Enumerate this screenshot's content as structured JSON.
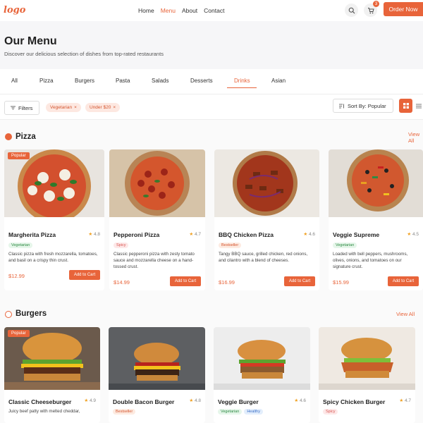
{
  "nav": {
    "logo": "logo",
    "links": [
      "Home",
      "Menu",
      "About",
      "Contact"
    ],
    "active_link": "Menu",
    "cart_count": "3",
    "order_now": "Order Now"
  },
  "hero": {
    "title": "Our Menu",
    "subtitle": "Discover our delicious selection of dishes from top-rated restaurants"
  },
  "tabs": {
    "items": [
      "All",
      "Pizza",
      "Burgers",
      "Pasta",
      "Salads",
      "Desserts",
      "Drinks",
      "Asian"
    ],
    "active": "Drinks"
  },
  "filters": {
    "button_label": "Filters",
    "chips": [
      "Vegetarian",
      "Under $20"
    ],
    "sort_label": "Sort By: Popular"
  },
  "sections": [
    {
      "title": "Pizza",
      "view_all": "View All",
      "items": [
        {
          "name": "Margherita Pizza",
          "rating": "4.8",
          "badge": "Popular",
          "tags": [
            "Vegetarian"
          ],
          "description": "Classic pizza with fresh mozzarella, tomatoes, and basil on a crispy thin crust.",
          "price": "$12.99",
          "add_label": "Add to Cart"
        },
        {
          "name": "Pepperoni Pizza",
          "rating": "4.7",
          "tags": [
            "Spicy"
          ],
          "description": "Classic pepperoni pizza with zesty tomato sauce and mozzarella cheese on a hand-tossed crust.",
          "price": "$14.99",
          "add_label": "Add to Cart"
        },
        {
          "name": "BBQ Chicken Pizza",
          "rating": "4.6",
          "tags": [
            "Bestseller"
          ],
          "description": "Tangy BBQ sauce, grilled chicken, red onions, and cilantro with a blend of cheeses.",
          "price": "$16.99",
          "add_label": "Add to Cart"
        },
        {
          "name": "Veggie Supreme",
          "rating": "4.5",
          "tags": [
            "Vegetarian"
          ],
          "description": "Loaded with bell peppers, mushrooms, olives, onions, and tomatoes on our signature crust.",
          "price": "$15.99",
          "add_label": "Add to Cart"
        }
      ]
    },
    {
      "title": "Burgers",
      "view_all": "View All",
      "items": [
        {
          "name": "Classic Cheeseburger",
          "rating": "4.9",
          "badge": "Popular",
          "tags": [],
          "description": "Juicy beef patty with melted cheddar,"
        },
        {
          "name": "Double Bacon Burger",
          "rating": "4.8",
          "tags": [
            "Bestseller"
          ]
        },
        {
          "name": "Veggie Burger",
          "rating": "4.6",
          "tags": [
            "Vegetarian",
            "Healthy"
          ]
        },
        {
          "name": "Spicy Chicken Burger",
          "rating": "4.7",
          "tags": [
            "Spicy"
          ]
        }
      ]
    }
  ],
  "colors": {
    "accent": "#e8643a",
    "background": "#fafafa"
  },
  "icons": [
    "search-icon",
    "cart-icon",
    "filter-icon",
    "sort-icon",
    "grid-icon",
    "list-icon",
    "close-icon",
    "star-icon"
  ]
}
